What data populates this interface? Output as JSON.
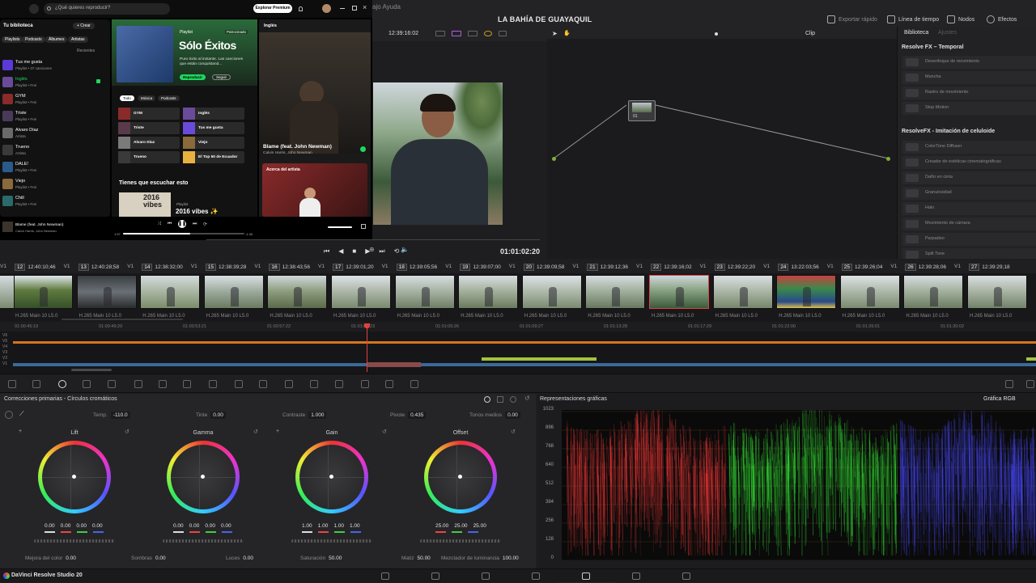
{
  "topbar": {
    "menu_fragment": "ajo  Ayuda",
    "project_title": "LA BAHÍA DE GUAYAQUIL",
    "buttons": [
      "Exportar rápido",
      "Línea de tiempo",
      "Nodos",
      "Efectos"
    ]
  },
  "viewer_toolbar": {
    "timecode_source": "12:39:16:02",
    "clip_label": "Clip"
  },
  "spotify": {
    "search_placeholder": "¿Qué quieres reproducir?",
    "premium_button": "Explorar Premium",
    "library_title": "Tu biblioteca",
    "create_button": "+ Crear",
    "filter_chips": [
      "Playlists",
      "Podcasts",
      "Álbumes",
      "Artistas"
    ],
    "recents_label": "Recientes",
    "library_items": [
      {
        "name": "Tus me gusta",
        "sub": "Playlist • 37 canciones",
        "color": "#5a3ad8"
      },
      {
        "name": "Inglés",
        "sub": "Playlist • Frei",
        "color": "#6a4a9a"
      },
      {
        "name": "GYM",
        "sub": "Playlist • Frei",
        "color": "#8a2a2a"
      },
      {
        "name": "Triste",
        "sub": "Playlist • Frei",
        "color": "#4a3a5a"
      },
      {
        "name": "Alvaro Díaz",
        "sub": "Artista",
        "color": "#6a6a6a"
      },
      {
        "name": "Trueno",
        "sub": "Artista",
        "color": "#3a3a3a"
      },
      {
        "name": "DALE!",
        "sub": "Playlist • Frei",
        "color": "#2a5a8a"
      },
      {
        "name": "Viejo",
        "sub": "Playlist • Frei",
        "color": "#8a6a3a"
      },
      {
        "name": "Chill",
        "sub": "Playlist • Frei",
        "color": "#2a6a6a"
      }
    ],
    "hero": {
      "kind": "Playlist",
      "title": "Sólo Éxitos",
      "desc": "Puro éxito al instante. Las canciones que están conquistand...",
      "play_button": "Reproducir",
      "follow_button": "Seguir",
      "tag": "Patrocinado"
    },
    "main_chips": [
      "Todo",
      "Música",
      "Podcasts"
    ],
    "grid_items": [
      "GYM",
      "Inglés",
      "Triste",
      "Tus me gusta",
      "Alvaro Díaz",
      "Viejo",
      "Trueno",
      "El Top 50 de Ecuador"
    ],
    "section_title": "Tienes que escuchar esto",
    "section_card": {
      "kind": "Playlist",
      "title": "2016 vibes ✨",
      "cover_text": "2016 vibes"
    },
    "right_panel": {
      "header": "Inglés",
      "song_title": "Blame (feat. John Newman)",
      "song_artist": "Calvin Harris, John Newman",
      "about_label": "Acerca del artista"
    },
    "player": {
      "song": "Blame (feat. John Newman)",
      "artist": "Calvin Harris, John Newman",
      "time_elapsed": "1:57",
      "time_total": "-1:35"
    }
  },
  "transport": {
    "timecode": "01:01:02:20"
  },
  "node": {
    "label": "01"
  },
  "fx_library": {
    "tabs": [
      "Biblioteca",
      "Ajustes"
    ],
    "sections": [
      {
        "title": "Resolve FX – Temporal",
        "items": [
          "Desenfoque de movimiento",
          "Mancha",
          "Rastro de movimiento",
          "Stop Motion"
        ]
      },
      {
        "title": "ResolveFX - Imitación de celuloide",
        "items": [
          "ColorTone Diffuser",
          "Creador de estéticas cinematográficas",
          "Daño en cinta",
          "Granulosidad",
          "Halo",
          "Movimiento de cámara",
          "Parpadeo",
          "Split Tone"
        ]
      }
    ]
  },
  "clips": {
    "headers": [
      {
        "n": "12",
        "tc": "12:40:10;46",
        "v": "V1"
      },
      {
        "n": "13",
        "tc": "12:40:28;58",
        "v": "V1"
      },
      {
        "n": "14",
        "tc": "12:38:32;00",
        "v": "V1"
      },
      {
        "n": "15",
        "tc": "12:38:39;28",
        "v": "V1"
      },
      {
        "n": "16",
        "tc": "12:38:43;56",
        "v": "V1"
      },
      {
        "n": "17",
        "tc": "12:39:01;20",
        "v": "V1"
      },
      {
        "n": "18",
        "tc": "12:39:05;56",
        "v": "V1"
      },
      {
        "n": "19",
        "tc": "12:39:07;00",
        "v": "V1"
      },
      {
        "n": "20",
        "tc": "12:39:09;58",
        "v": "V1"
      },
      {
        "n": "21",
        "tc": "12:39:12;36",
        "v": "V1"
      },
      {
        "n": "22",
        "tc": "12:39:16;02",
        "v": "V1"
      },
      {
        "n": "23",
        "tc": "12:39:22;20",
        "v": "V1"
      },
      {
        "n": "24",
        "tc": "13:22:03;56",
        "v": "V1"
      },
      {
        "n": "25",
        "tc": "12:39:26;04",
        "v": "V1"
      },
      {
        "n": "26",
        "tc": "12:39:28;06",
        "v": "V1"
      },
      {
        "n": "27",
        "tc": "12:39:29;18",
        "v": "V1"
      }
    ],
    "codec_label": "H.265 Main 10 L5.0",
    "selected_index": 10
  },
  "timeline": {
    "ruler": [
      "01:00:45:19",
      "01:00:49:20",
      "01:00:53:21",
      "01:00:57:22",
      "01:01:01:23",
      "01:01:05:26",
      "01:01:09:27",
      "01:01:13:28",
      "01:01:17:29",
      "01:01:22:00",
      "01:01:26:01",
      "01:01:30:02"
    ],
    "tracks": [
      "V6",
      "V5",
      "V4",
      "V3",
      "V2",
      "V1"
    ]
  },
  "primaries": {
    "title": "Correcciones primarias - Círculos cromáticos",
    "params": [
      {
        "label": "Temp.",
        "value": "-110.0"
      },
      {
        "label": "Tinte",
        "value": "0.00"
      },
      {
        "label": "Contraste",
        "value": "1.000"
      },
      {
        "label": "Pivote",
        "value": "0.435"
      },
      {
        "label": "Tonos medios",
        "value": "0.00"
      }
    ],
    "wheels": [
      {
        "name": "Lift",
        "values": [
          "0.00",
          "0.00",
          "0.00",
          "0.00"
        ]
      },
      {
        "name": "Gamma",
        "values": [
          "0.00",
          "0.00",
          "0.00",
          "0.00"
        ]
      },
      {
        "name": "Gain",
        "values": [
          "1.00",
          "1.00",
          "1.00",
          "1.00"
        ]
      },
      {
        "name": "Offset",
        "values": [
          "25.00",
          "25.00",
          "25.00"
        ]
      }
    ],
    "bottom_params": [
      {
        "label": "Mejora del color",
        "value": "0.00"
      },
      {
        "label": "Sombras",
        "value": "0.00"
      },
      {
        "label": "Luces",
        "value": "0.00"
      },
      {
        "label": "Saturación",
        "value": "50.00"
      },
      {
        "label": "Matiz",
        "value": "50.00"
      },
      {
        "label": "Mezclador de luminancia",
        "value": "100.00"
      }
    ]
  },
  "scopes": {
    "title": "Representaciones gráficas",
    "mode": "Gráfica RGB",
    "y_ticks": [
      "1023",
      "896",
      "768",
      "640",
      "512",
      "384",
      "256",
      "128",
      "0"
    ]
  },
  "statusbar": {
    "app_name": "DaVinci Resolve Studio 20"
  }
}
